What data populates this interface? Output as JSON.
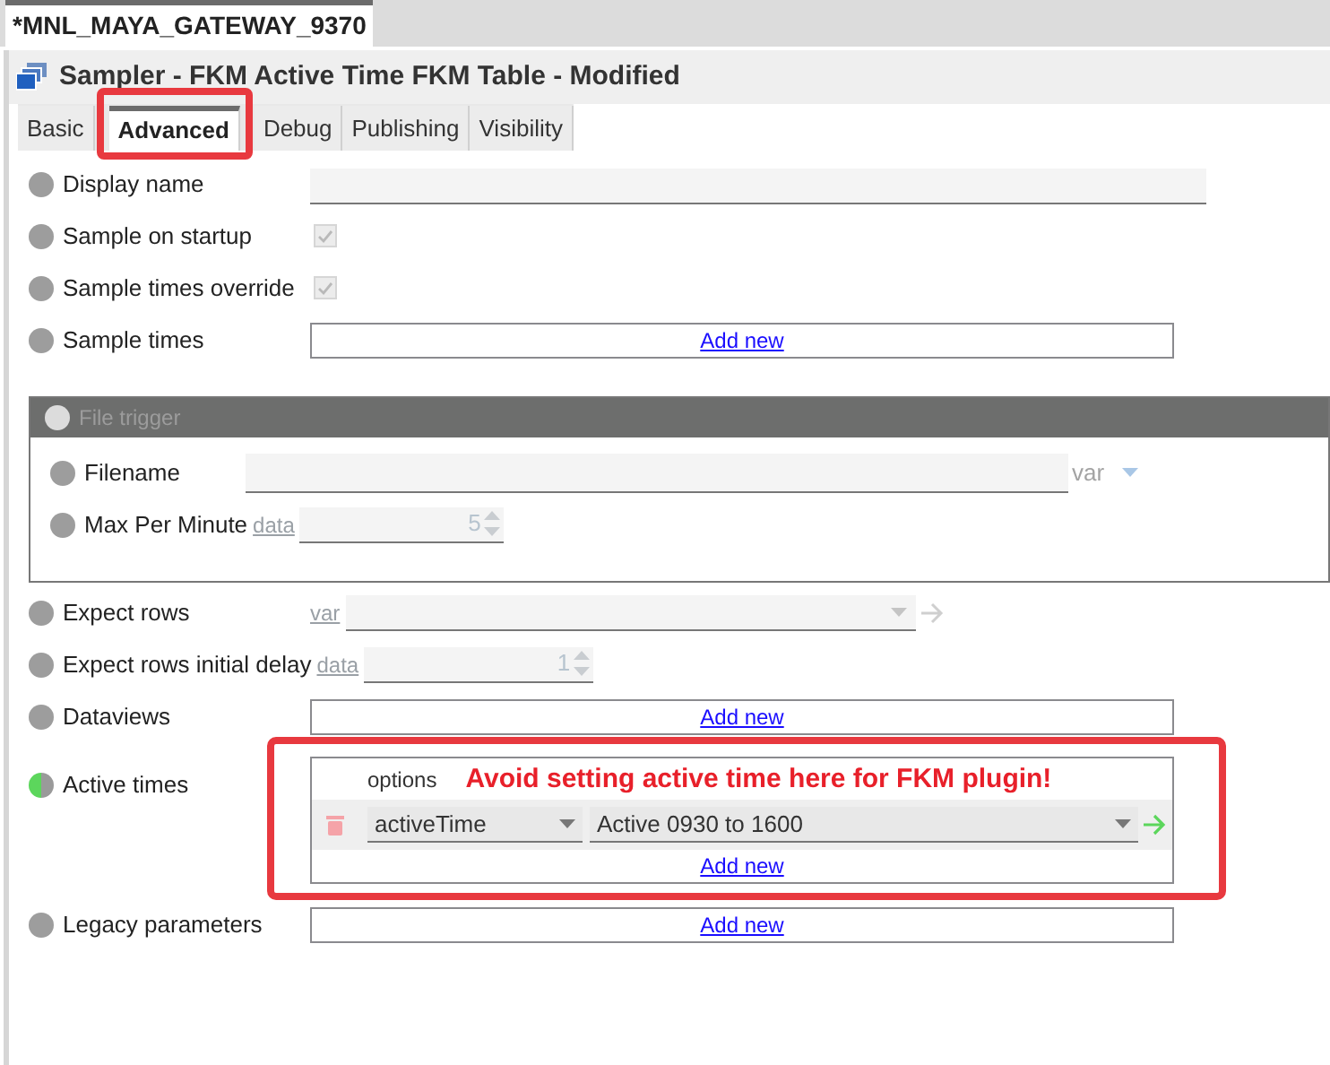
{
  "document_tab": {
    "label": "*MNL_MAYA_GATEWAY_9370",
    "selected": true
  },
  "title": "Sampler - FKM Active Time FKM Table - Modified",
  "tabs": [
    {
      "label": "Basic",
      "selected": false,
      "annotated": false
    },
    {
      "label": "Advanced",
      "selected": true,
      "annotated": true
    },
    {
      "label": "Debug",
      "selected": false,
      "annotated": false
    },
    {
      "label": "Publishing",
      "selected": false,
      "annotated": false
    },
    {
      "label": "Visibility",
      "selected": false,
      "annotated": false
    }
  ],
  "fields": [
    {
      "kind": "text",
      "label": "Display name",
      "set": false
    },
    {
      "kind": "checkbox",
      "label": "Sample on startup",
      "set": false,
      "checked": true
    },
    {
      "kind": "checkbox",
      "label": "Sample times override",
      "set": false,
      "checked": true
    },
    {
      "kind": "list",
      "label": "Sample times",
      "set": false,
      "add_link": "Add new"
    },
    {
      "kind": "section",
      "label": "File trigger",
      "fields": [
        {
          "kind": "text_var",
          "label": "Filename",
          "set": false,
          "mode": "var"
        },
        {
          "kind": "spinner",
          "label": "Max Per Minute",
          "set": false,
          "mode": "data",
          "value": "5"
        }
      ]
    },
    {
      "kind": "select",
      "label": "Expect rows",
      "set": false,
      "mode": "var"
    },
    {
      "kind": "spinner",
      "label": "Expect rows initial delay",
      "set": false,
      "mode": "data",
      "value": "1"
    },
    {
      "kind": "list",
      "label": "Dataviews",
      "set": false,
      "add_link": "Add new"
    },
    {
      "kind": "option_list",
      "label": "Active times",
      "set": true,
      "column": "options",
      "note": "Avoid setting active time here for FKM plugin!",
      "annotated": true,
      "rows": [
        {
          "option": "activeTime",
          "value": "Active 0930 to 1600"
        }
      ],
      "add_link": "Add new"
    },
    {
      "kind": "list",
      "label": "Legacy parameters",
      "set": false,
      "add_link": "Add new"
    }
  ]
}
